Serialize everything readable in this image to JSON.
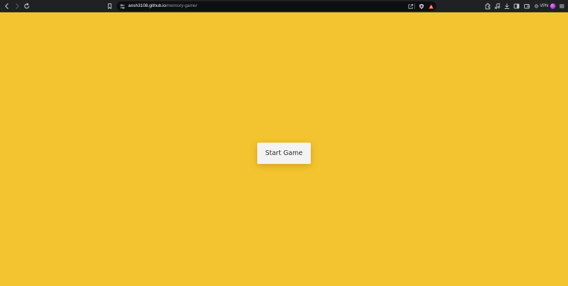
{
  "browser": {
    "url_host": "ansh3108.github.io",
    "url_path": "/memory-game/",
    "vpn_label": "VPN"
  },
  "page": {
    "start_button_label": "Start Game"
  },
  "colors": {
    "page_background": "#f4c430",
    "button_background": "#f3f3f3",
    "toolbar_background": "#202124"
  },
  "icons": {
    "toolbar": [
      "back-icon",
      "forward-icon",
      "reload-icon",
      "bookmark-icon"
    ],
    "addressbar": [
      "site-settings-icon",
      "share-icon",
      "brave-shields-icon",
      "brave-rewards-icon"
    ],
    "right": [
      "extensions-icon",
      "media-icon",
      "downloads-icon",
      "sidebar-icon",
      "wallet-icon",
      "vpn-icon",
      "profile-icon",
      "menu-icon"
    ]
  }
}
